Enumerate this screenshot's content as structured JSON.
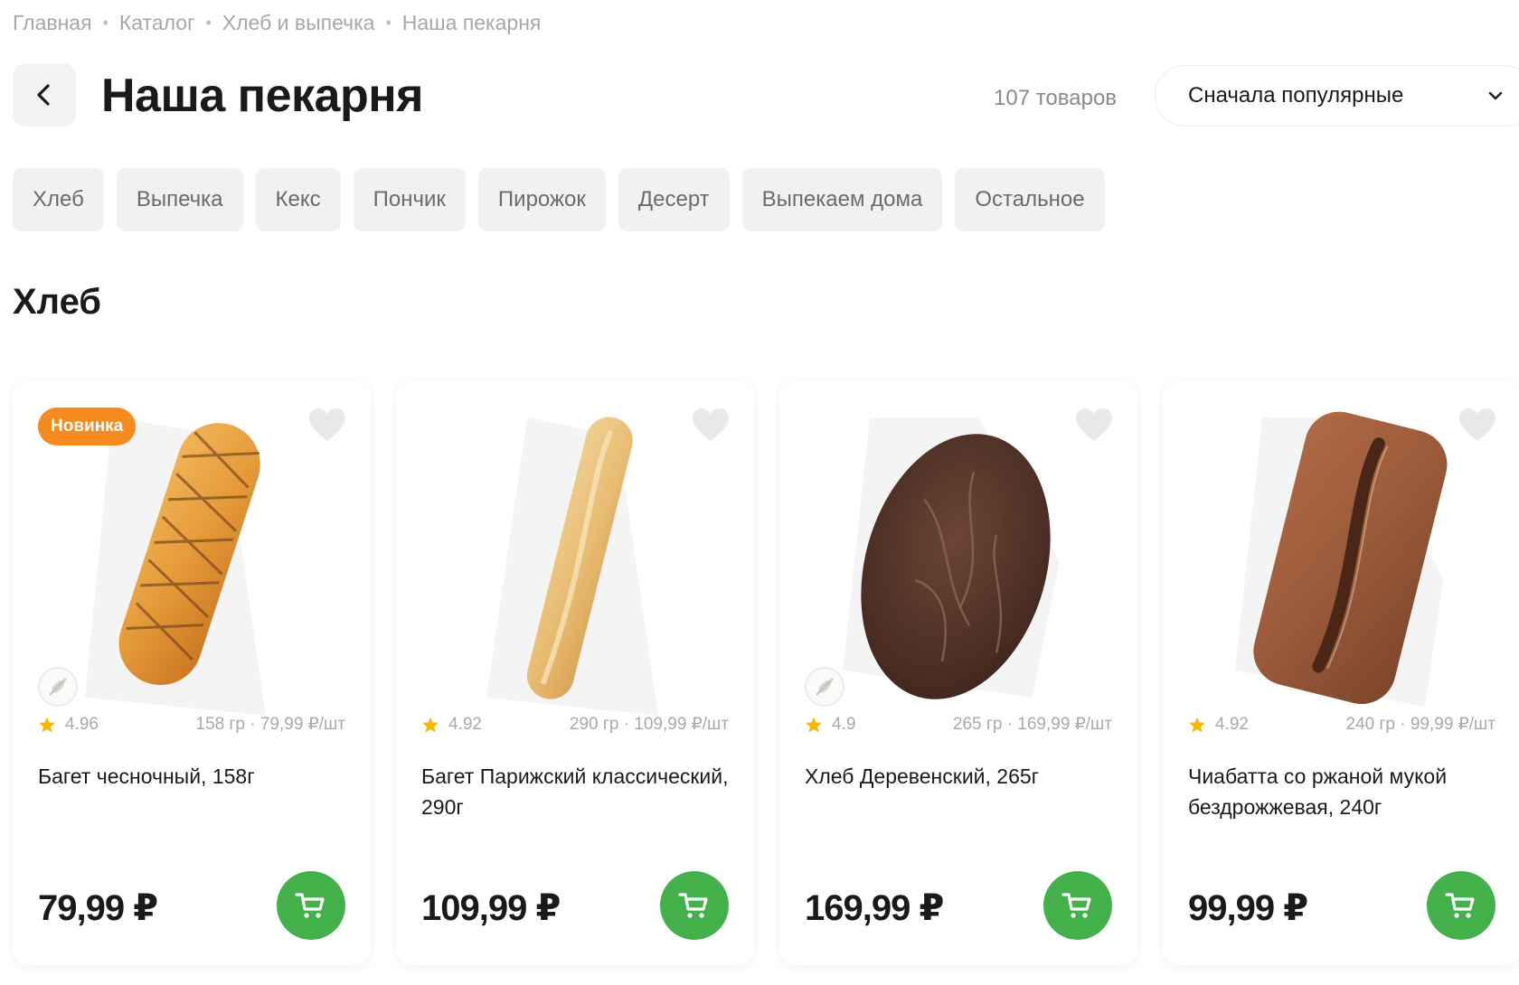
{
  "breadcrumb": [
    "Главная",
    "Каталог",
    "Хлеб и выпечка",
    "Наша пекарня"
  ],
  "header": {
    "title": "Наша пекарня",
    "count": "107 товаров",
    "sort_label": "Сначала популярные"
  },
  "chips": [
    "Хлеб",
    "Выпечка",
    "Кекс",
    "Пончик",
    "Пирожок",
    "Десерт",
    "Выпекаем дома",
    "Остальное"
  ],
  "section_title": "Хлеб",
  "products": [
    {
      "badge": "Новинка",
      "has_veg_icon": true,
      "rating": "4.96",
      "weight_price": "158 гр · 79,99 ₽/шт",
      "name": "Багет чесночный, 158г",
      "price": "79,99 ₽",
      "image": "garlic-baguette"
    },
    {
      "badge": "",
      "has_veg_icon": false,
      "rating": "4.92",
      "weight_price": "290 гр · 109,99 ₽/шт",
      "name": "Багет Парижский классический, 290г",
      "price": "109,99 ₽",
      "image": "paris-baguette"
    },
    {
      "badge": "",
      "has_veg_icon": true,
      "rating": "4.9",
      "weight_price": "265 гр · 169,99 ₽/шт",
      "name": "Хлеб Деревенский, 265г",
      "price": "169,99 ₽",
      "image": "village-bread"
    },
    {
      "badge": "",
      "has_veg_icon": false,
      "rating": "4.92",
      "weight_price": "240 гр · 99,99 ₽/шт",
      "name": "Чиабатта со ржаной мукой бездрожжевая, 240г",
      "price": "99,99 ₽",
      "image": "rye-ciabatta"
    }
  ],
  "colors": {
    "accent_green": "#44b049",
    "badge_orange": "#f58a1f",
    "star": "#f7b500",
    "chip_bg": "#f1f1f2"
  }
}
